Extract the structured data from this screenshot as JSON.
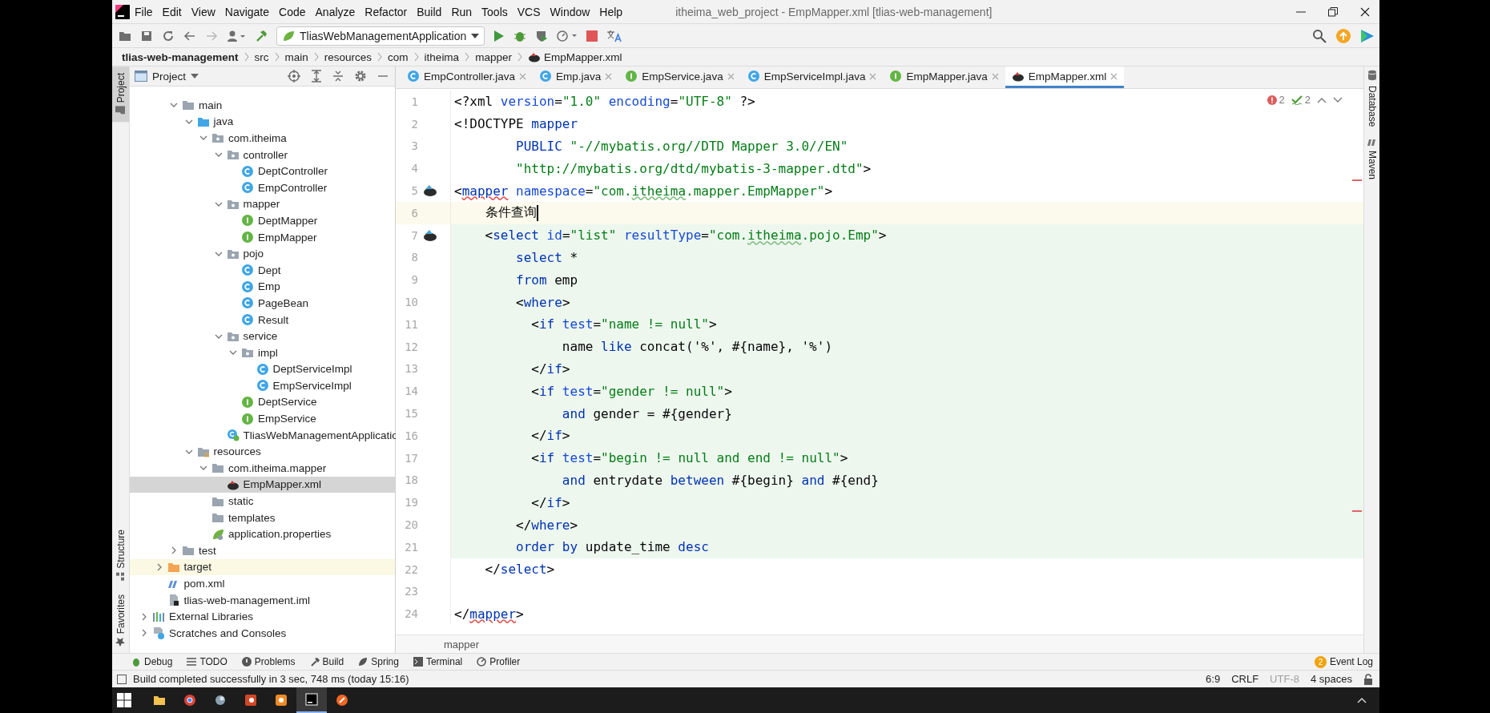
{
  "menu_bar": {
    "items": [
      "File",
      "Edit",
      "View",
      "Navigate",
      "Code",
      "Analyze",
      "Refactor",
      "Build",
      "Run",
      "Tools",
      "VCS",
      "Window",
      "Help"
    ],
    "title": "itheima_web_project - EmpMapper.xml [tlias-web-management]"
  },
  "toolbar": {
    "run_configuration": "TliasWebManagementApplication"
  },
  "navigation_bar": [
    "tlias-web-management",
    "src",
    "main",
    "resources",
    "com",
    "itheima",
    "mapper",
    "EmpMapper.xml"
  ],
  "left_strip": [
    {
      "label": "Project",
      "selected": true,
      "kind": "project"
    },
    {
      "label": "Structure",
      "selected": false,
      "kind": "structure"
    },
    {
      "label": "Favorites",
      "selected": false,
      "kind": "favorites"
    }
  ],
  "project_panel": {
    "title": "Project",
    "tree": [
      {
        "children": [
          {
            "children": [
              {
                "label": "main",
                "kind": "folder",
                "expanded": true,
                "selected": false,
                "children": [
                  {
                    "label": "java",
                    "kind": "source-folder",
                    "expanded": true,
                    "selected": false,
                    "children": [
                      {
                        "label": "com.itheima",
                        "kind": "package",
                        "expanded": true,
                        "selected": false,
                        "children": [
                          {
                            "label": "controller",
                            "kind": "package",
                            "expanded": true,
                            "selected": false,
                            "children": [
                              {
                                "label": "DeptController",
                                "kind": "class",
                                "selected": false
                              },
                              {
                                "label": "EmpController",
                                "kind": "class",
                                "selected": false
                              }
                            ]
                          },
                          {
                            "label": "mapper",
                            "kind": "package",
                            "expanded": true,
                            "selected": false,
                            "children": [
                              {
                                "label": "DeptMapper",
                                "kind": "interface",
                                "selected": false
                              },
                              {
                                "label": "EmpMapper",
                                "kind": "interface",
                                "selected": false
                              }
                            ]
                          },
                          {
                            "label": "pojo",
                            "kind": "package",
                            "expanded": true,
                            "selected": false,
                            "children": [
                              {
                                "label": "Dept",
                                "kind": "class",
                                "selected": false
                              },
                              {
                                "label": "Emp",
                                "kind": "class",
                                "selected": false
                              },
                              {
                                "label": "PageBean",
                                "kind": "class",
                                "selected": false
                              },
                              {
                                "label": "Result",
                                "kind": "class",
                                "selected": false
                              }
                            ]
                          },
                          {
                            "label": "service",
                            "kind": "package",
                            "expanded": true,
                            "selected": false,
                            "children": [
                              {
                                "label": "impl",
                                "kind": "package",
                                "expanded": true,
                                "selected": false,
                                "children": [
                                  {
                                    "label": "DeptServiceImpl",
                                    "kind": "class",
                                    "selected": false
                                  },
                                  {
                                    "label": "EmpServiceImpl",
                                    "kind": "class",
                                    "selected": false
                                  }
                                ]
                              },
                              {
                                "label": "DeptService",
                                "kind": "interface",
                                "selected": false
                              },
                              {
                                "label": "EmpService",
                                "kind": "interface",
                                "selected": false
                              }
                            ]
                          },
                          {
                            "label": "TliasWebManagementApplicatio",
                            "kind": "spring-class",
                            "selected": false
                          }
                        ]
                      }
                    ]
                  },
                  {
                    "label": "resources",
                    "kind": "resources-folder",
                    "expanded": true,
                    "selected": false,
                    "children": [
                      {
                        "label": "com.itheima.mapper",
                        "kind": "folder",
                        "expanded": true,
                        "selected": false,
                        "children": [
                          {
                            "label": "EmpMapper.xml",
                            "kind": "mybatis-xml",
                            "selected": true
                          }
                        ]
                      },
                      {
                        "label": "static",
                        "kind": "folder",
                        "selected": false
                      },
                      {
                        "label": "templates",
                        "kind": "folder",
                        "selected": false
                      },
                      {
                        "label": "application.properties",
                        "kind": "properties",
                        "selected": false
                      }
                    ]
                  }
                ]
              },
              {
                "label": "test",
                "kind": "folder",
                "expanded": false,
                "selected": false
              }
            ]
          },
          {
            "label": "target",
            "kind": "excluded-folder",
            "expanded": false,
            "selected": false
          },
          {
            "label": "pom.xml",
            "kind": "maven",
            "selected": false
          },
          {
            "label": "tlias-web-management.iml",
            "kind": "module-file",
            "selected": false
          }
        ]
      },
      {
        "label": "External Libraries",
        "kind": "libraries",
        "expanded": false,
        "selected": false
      },
      {
        "label": "Scratches and Consoles",
        "kind": "scratches",
        "expanded": false,
        "selected": false
      }
    ]
  },
  "editor_tabs": [
    {
      "label": "EmpController.java",
      "kind": "class",
      "selected": false
    },
    {
      "label": "Emp.java",
      "kind": "class",
      "selected": false
    },
    {
      "label": "EmpService.java",
      "kind": "interface",
      "selected": false
    },
    {
      "label": "EmpServiceImpl.java",
      "kind": "class",
      "selected": false
    },
    {
      "label": "EmpMapper.java",
      "kind": "interface",
      "selected": false
    },
    {
      "label": "EmpMapper.xml",
      "kind": "mybatis-xml",
      "selected": true
    }
  ],
  "editor": {
    "inspections": {
      "errors": "2",
      "warnings": "2"
    },
    "breadcrumb": "mapper",
    "lines": [
      {
        "number": "1",
        "kind": "plain",
        "gutter_icon": false,
        "tokens": [
          {
            "kind": "text",
            "text": "<?xml "
          },
          {
            "kind": "attr",
            "text": "version"
          },
          {
            "kind": "text",
            "text": "="
          },
          {
            "kind": "string",
            "text": "\"1.0\""
          },
          {
            "kind": "attr",
            "text": " encoding"
          },
          {
            "kind": "text",
            "text": "="
          },
          {
            "kind": "string",
            "text": "\"UTF-8\""
          },
          {
            "kind": "text",
            "text": " ?>"
          }
        ]
      },
      {
        "number": "2",
        "kind": "plain",
        "gutter_icon": false,
        "tokens": [
          {
            "kind": "text",
            "text": "<!DOCTYPE "
          },
          {
            "kind": "tag",
            "text": "mapper"
          }
        ]
      },
      {
        "number": "3",
        "kind": "plain",
        "gutter_icon": false,
        "tokens": [
          {
            "kind": "keyword",
            "text": "        PUBLIC"
          },
          {
            "kind": "string",
            "text": " \"-//mybatis.org//DTD Mapper 3.0//EN\""
          }
        ]
      },
      {
        "number": "4",
        "kind": "plain",
        "gutter_icon": false,
        "tokens": [
          {
            "kind": "string",
            "text": "        \"http://mybatis.org/dtd/mybatis-3-mapper.dtd\""
          },
          {
            "kind": "text",
            "text": ">"
          }
        ]
      },
      {
        "number": "5",
        "kind": "plain",
        "gutter_icon": true,
        "tokens": [
          {
            "kind": "text",
            "text": "<"
          },
          {
            "kind": "tag-unresolved",
            "text": "mapper"
          },
          {
            "kind": "attr",
            "text": " namespace"
          },
          {
            "kind": "text",
            "text": "="
          },
          {
            "kind": "string",
            "text": "\"com."
          },
          {
            "kind": "string-misspelled",
            "text": "itheima"
          },
          {
            "kind": "string",
            "text": ".mapper.EmpMapper\""
          },
          {
            "kind": "text",
            "text": ">"
          }
        ]
      },
      {
        "number": "6",
        "kind": "current",
        "gutter_icon": false,
        "caret": true,
        "tokens": [
          {
            "kind": "text",
            "text": "    条件查询"
          }
        ]
      },
      {
        "number": "7",
        "kind": "injected",
        "gutter_icon": true,
        "tokens": [
          {
            "kind": "text",
            "text": "    <"
          },
          {
            "kind": "tag",
            "text": "select"
          },
          {
            "kind": "attr",
            "text": " id"
          },
          {
            "kind": "text",
            "text": "="
          },
          {
            "kind": "string",
            "text": "\"list\""
          },
          {
            "kind": "attr",
            "text": " resultType"
          },
          {
            "kind": "text",
            "text": "="
          },
          {
            "kind": "string",
            "text": "\"com."
          },
          {
            "kind": "string-misspelled",
            "text": "itheima"
          },
          {
            "kind": "string",
            "text": ".pojo.Emp\""
          },
          {
            "kind": "text",
            "text": ">"
          }
        ]
      },
      {
        "number": "8",
        "kind": "injected",
        "gutter_icon": false,
        "tokens": [
          {
            "kind": "keyword",
            "text": "        select"
          },
          {
            "kind": "text",
            "text": " *"
          }
        ]
      },
      {
        "number": "9",
        "kind": "injected",
        "gutter_icon": false,
        "tokens": [
          {
            "kind": "keyword",
            "text": "        from"
          },
          {
            "kind": "text",
            "text": " emp"
          }
        ]
      },
      {
        "number": "10",
        "kind": "injected",
        "gutter_icon": false,
        "tokens": [
          {
            "kind": "text",
            "text": "        <"
          },
          {
            "kind": "tag",
            "text": "where"
          },
          {
            "kind": "text",
            "text": ">"
          }
        ]
      },
      {
        "number": "11",
        "kind": "injected",
        "gutter_icon": false,
        "tokens": [
          {
            "kind": "text",
            "text": "          <"
          },
          {
            "kind": "tag",
            "text": "if"
          },
          {
            "kind": "attr",
            "text": " test"
          },
          {
            "kind": "text",
            "text": "="
          },
          {
            "kind": "string",
            "text": "\"name != null\""
          },
          {
            "kind": "text",
            "text": ">"
          }
        ]
      },
      {
        "number": "12",
        "kind": "injected",
        "gutter_icon": false,
        "tokens": [
          {
            "kind": "text",
            "text": "              name "
          },
          {
            "kind": "keyword",
            "text": "like"
          },
          {
            "kind": "text",
            "text": " concat('%', #{name}, '%')"
          }
        ]
      },
      {
        "number": "13",
        "kind": "injected",
        "gutter_icon": false,
        "tokens": [
          {
            "kind": "text",
            "text": "          </"
          },
          {
            "kind": "tag",
            "text": "if"
          },
          {
            "kind": "text",
            "text": ">"
          }
        ]
      },
      {
        "number": "14",
        "kind": "injected",
        "gutter_icon": false,
        "tokens": [
          {
            "kind": "text",
            "text": "          <"
          },
          {
            "kind": "tag",
            "text": "if"
          },
          {
            "kind": "attr",
            "text": " test"
          },
          {
            "kind": "text",
            "text": "="
          },
          {
            "kind": "string",
            "text": "\"gender != null\""
          },
          {
            "kind": "text",
            "text": ">"
          }
        ]
      },
      {
        "number": "15",
        "kind": "injected",
        "gutter_icon": false,
        "tokens": [
          {
            "kind": "keyword",
            "text": "              and"
          },
          {
            "kind": "text",
            "text": " gender = #{gender}"
          }
        ]
      },
      {
        "number": "16",
        "kind": "injected",
        "gutter_icon": false,
        "tokens": [
          {
            "kind": "text",
            "text": "          </"
          },
          {
            "kind": "tag",
            "text": "if"
          },
          {
            "kind": "text",
            "text": ">"
          }
        ]
      },
      {
        "number": "17",
        "kind": "injected",
        "gutter_icon": false,
        "tokens": [
          {
            "kind": "text",
            "text": "          <"
          },
          {
            "kind": "tag",
            "text": "if"
          },
          {
            "kind": "attr",
            "text": " test"
          },
          {
            "kind": "text",
            "text": "="
          },
          {
            "kind": "string",
            "text": "\"begin != null and end != null\""
          },
          {
            "kind": "text",
            "text": ">"
          }
        ]
      },
      {
        "number": "18",
        "kind": "injected",
        "gutter_icon": false,
        "tokens": [
          {
            "kind": "keyword",
            "text": "              and"
          },
          {
            "kind": "text",
            "text": " entrydate "
          },
          {
            "kind": "keyword",
            "text": "between"
          },
          {
            "kind": "text",
            "text": " #{begin} "
          },
          {
            "kind": "keyword",
            "text": "and"
          },
          {
            "kind": "text",
            "text": " #{end}"
          }
        ]
      },
      {
        "number": "19",
        "kind": "injected",
        "gutter_icon": false,
        "tokens": [
          {
            "kind": "text",
            "text": "          </"
          },
          {
            "kind": "tag",
            "text": "if"
          },
          {
            "kind": "text",
            "text": ">"
          }
        ]
      },
      {
        "number": "20",
        "kind": "injected",
        "gutter_icon": false,
        "tokens": [
          {
            "kind": "text",
            "text": "        </"
          },
          {
            "kind": "tag",
            "text": "where"
          },
          {
            "kind": "text",
            "text": ">"
          }
        ]
      },
      {
        "number": "21",
        "kind": "injected",
        "gutter_icon": false,
        "tokens": [
          {
            "kind": "keyword",
            "text": "        order by"
          },
          {
            "kind": "text",
            "text": " update_time "
          },
          {
            "kind": "keyword",
            "text": "desc"
          }
        ]
      },
      {
        "number": "22",
        "kind": "plain",
        "gutter_icon": false,
        "tokens": [
          {
            "kind": "text",
            "text": "    </"
          },
          {
            "kind": "tag",
            "text": "select"
          },
          {
            "kind": "text",
            "text": ">"
          }
        ]
      },
      {
        "number": "23",
        "kind": "plain",
        "gutter_icon": false
      },
      {
        "number": "24",
        "kind": "plain",
        "gutter_icon": false,
        "tokens": [
          {
            "kind": "text",
            "text": "</"
          },
          {
            "kind": "tag-unresolved",
            "text": "mapper"
          },
          {
            "kind": "text",
            "text": ">"
          }
        ]
      }
    ]
  },
  "right_strip": [
    {
      "label": "Database",
      "kind": "database"
    },
    {
      "label": "Maven",
      "kind": "maven"
    }
  ],
  "tool_windows": [
    {
      "label": "Debug",
      "kind": "debug"
    },
    {
      "label": "TODO",
      "kind": "todo"
    },
    {
      "label": "Problems",
      "kind": "problems"
    },
    {
      "label": "Build",
      "kind": "build"
    },
    {
      "label": "Spring",
      "kind": "spring"
    },
    {
      "label": "Terminal",
      "kind": "terminal"
    },
    {
      "label": "Profiler",
      "kind": "profiler"
    }
  ],
  "event_log": {
    "label": "Event Log",
    "count": "2"
  },
  "status_bar": {
    "message": "Build completed successfully in 3 sec, 748 ms (today 15:16)",
    "position": "6:9",
    "line_separator": "CRLF",
    "encoding": {
      "text": "UTF-8",
      "disabled": true
    },
    "indent": "4 spaces"
  },
  "taskbar": {
    "apps": [
      {
        "kind": "explorer",
        "selected": false
      },
      {
        "kind": "browser",
        "selected": false
      },
      {
        "kind": "tool",
        "selected": false
      },
      {
        "kind": "slides",
        "selected": false
      },
      {
        "kind": "media",
        "selected": false
      },
      {
        "kind": "ide",
        "selected": true
      },
      {
        "kind": "draw",
        "selected": false
      }
    ]
  }
}
